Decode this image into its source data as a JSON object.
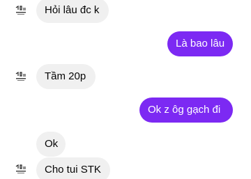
{
  "avatar": {
    "icon": "user-avatar-icon"
  },
  "colors": {
    "incoming_bubble": "#f0f0f0",
    "outgoing_bubble": "#7c29f3"
  },
  "messages": [
    {
      "direction": "incoming",
      "text": "Hỏi lâu đc k",
      "show_avatar": true
    },
    {
      "direction": "outgoing",
      "text": "Là bao lâu"
    },
    {
      "direction": "incoming",
      "text": "Tầm 20p",
      "show_avatar": true
    },
    {
      "direction": "outgoing",
      "text": "Ok z ôg gạch đi"
    },
    {
      "direction": "incoming",
      "text": "Ok",
      "show_avatar": false
    },
    {
      "direction": "incoming",
      "text": "Cho tui STK",
      "show_avatar": true
    }
  ]
}
